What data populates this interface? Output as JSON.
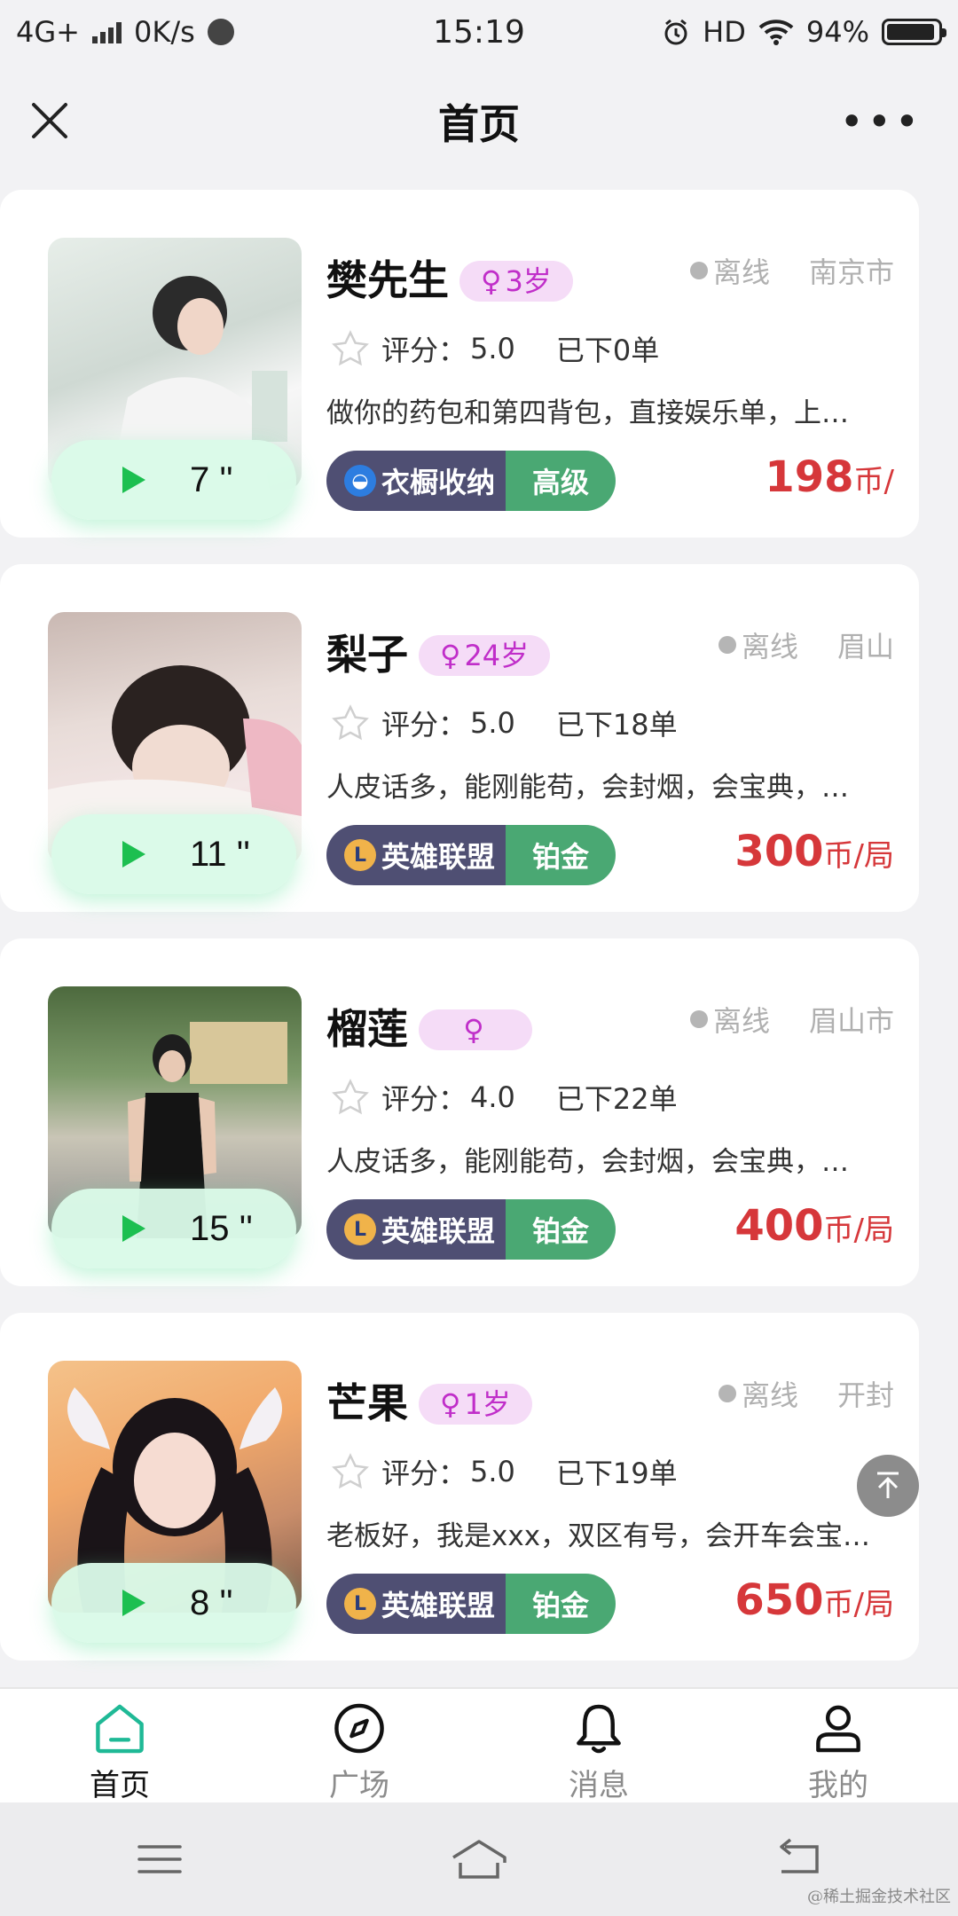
{
  "status_bar": {
    "network": "4G+",
    "speed": "0K/s",
    "time": "15:19",
    "hd": "HD",
    "battery_percent": "94%",
    "battery_level": 0.94
  },
  "nav": {
    "title": "首页",
    "more": "•••"
  },
  "cards": [
    {
      "name": "樊先生",
      "age": "3岁",
      "status": "离线",
      "city": "南京市",
      "rating_label": "评分：",
      "rating": "5.0",
      "orders": "已下0单",
      "desc": "做你的药包和第四背包，直接娱乐单，上…",
      "duration": "7 ''",
      "game": "衣橱收纳",
      "level": "高级",
      "price": "198",
      "unit": "币/"
    },
    {
      "name": "梨子",
      "age": "24岁",
      "status": "离线",
      "city": "眉山",
      "rating_label": "评分：",
      "rating": "5.0",
      "orders": "已下18单",
      "desc": "人皮话多，能刚能苟，会封烟，会宝典，…",
      "duration": "11 ''",
      "game": "英雄联盟",
      "level": "铂金",
      "price": "300",
      "unit": "币/局"
    },
    {
      "name": "榴莲",
      "age": "",
      "status": "离线",
      "city": "眉山市",
      "rating_label": "评分：",
      "rating": "4.0",
      "orders": "已下22单",
      "desc": "人皮话多，能刚能苟，会封烟，会宝典，…",
      "duration": "15 ''",
      "game": "英雄联盟",
      "level": "铂金",
      "price": "400",
      "unit": "币/局"
    },
    {
      "name": "芒果",
      "age": "1岁",
      "status": "离线",
      "city": "开封",
      "rating_label": "评分：",
      "rating": "5.0",
      "orders": "已下19单",
      "desc": "老板好，我是xxx，双区有号，会开车会宝…",
      "duration": "8 ''",
      "game": "英雄联盟",
      "level": "铂金",
      "price": "650",
      "unit": "币/局"
    }
  ],
  "tabs": [
    {
      "label": "首页",
      "icon": "home-icon"
    },
    {
      "label": "广场",
      "icon": "compass-icon"
    },
    {
      "label": "消息",
      "icon": "bell-icon"
    },
    {
      "label": "我的",
      "icon": "user-icon"
    }
  ],
  "female_symbol": "♀",
  "watermark": "@稀土掘金技术社区",
  "colors": {
    "accent_green": "#4aa873",
    "price_red": "#d6373a",
    "badge_pink": "#f5dcf7",
    "tag_dark": "#4f4f73"
  }
}
